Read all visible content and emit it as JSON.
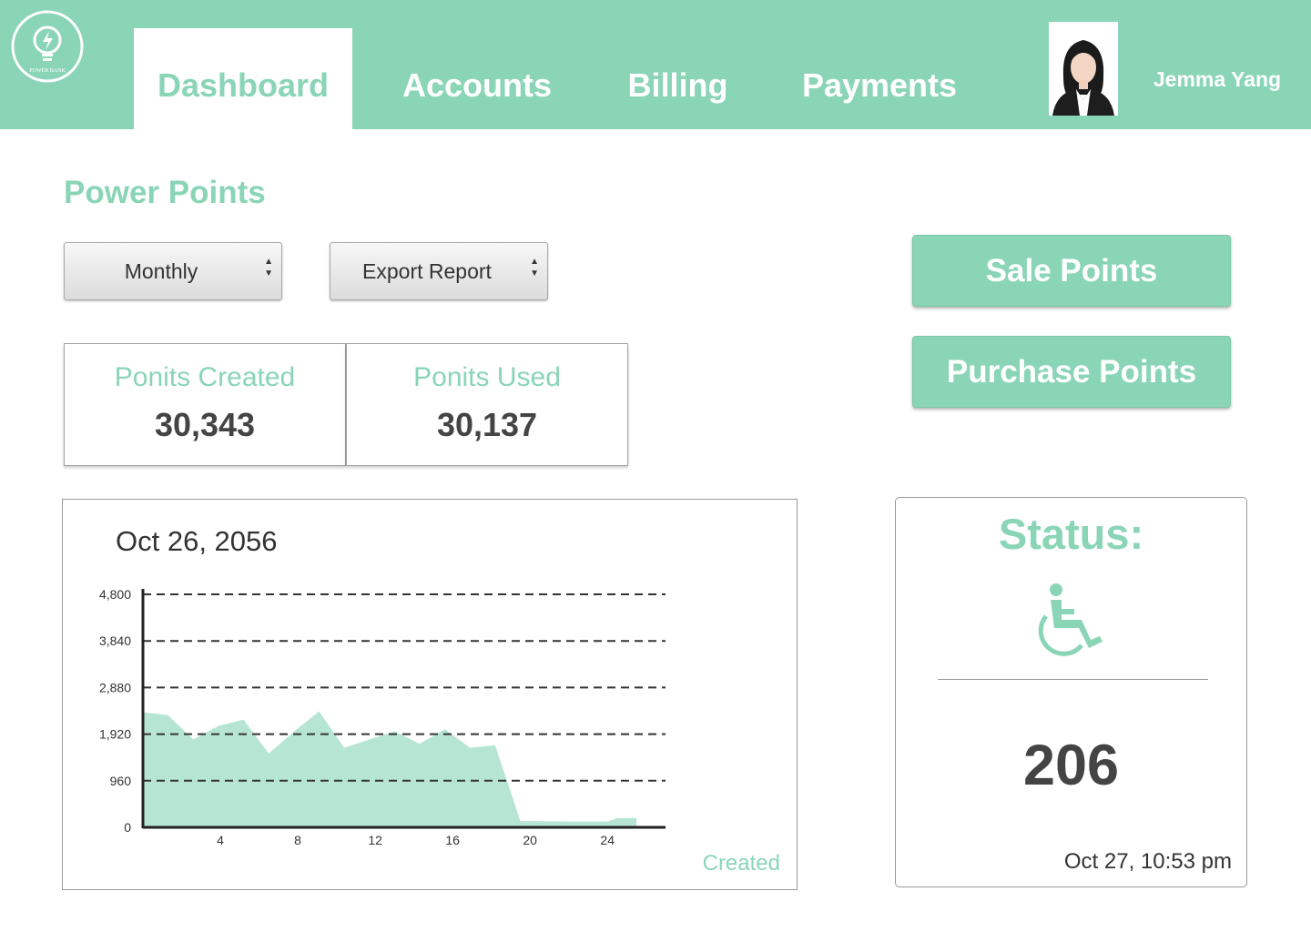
{
  "header": {
    "logo_text": "POWER BANK",
    "tabs": [
      {
        "label": "Dashboard",
        "active": true
      },
      {
        "label": "Accounts",
        "active": false
      },
      {
        "label": "Billing",
        "active": false
      },
      {
        "label": "Payments",
        "active": false
      }
    ],
    "user_name": "Jemma Yang"
  },
  "main": {
    "title": "Power Points",
    "period_select": "Monthly",
    "export_select": "Export Report",
    "stats": [
      {
        "label": "Ponits Created",
        "value": "30,343"
      },
      {
        "label": "Ponits Used",
        "value": "30,137"
      }
    ],
    "buttons": {
      "sale": "Sale Points",
      "purchase": "Purchase Points"
    }
  },
  "chart_data": {
    "type": "area",
    "title": "Oct 26, 2056",
    "xlabel": "",
    "ylabel": "",
    "x": [
      0,
      1.3,
      2.6,
      3.9,
      5.2,
      6.5,
      7.8,
      9.1,
      10.4,
      11.7,
      13,
      14.3,
      15.6,
      16.9,
      18.2,
      19.5,
      20.2,
      22.2,
      24,
      24.5,
      25.5
    ],
    "series": [
      {
        "name": "Created",
        "values": [
          2370,
          2310,
          1810,
          2090,
          2220,
          1520,
          1970,
          2390,
          1640,
          1810,
          1980,
          1720,
          2020,
          1640,
          1690,
          130,
          130,
          120,
          120,
          190,
          190
        ]
      }
    ],
    "xticks": [
      "4",
      "8",
      "12",
      "16",
      "20",
      "24"
    ],
    "yticks": [
      "0",
      "960",
      "1,920",
      "2,880",
      "3,840",
      "4,800"
    ],
    "xlim": [
      0,
      27
    ],
    "ylim": [
      0,
      4800
    ],
    "grid": true,
    "legend": "bottom-right",
    "color": "#b6e6d3"
  },
  "status": {
    "title": "Status:",
    "icon": "wheelchair-icon",
    "value": "206",
    "timestamp": "Oct 27, 10:53 pm"
  },
  "colors": {
    "accent": "#8ad5b6",
    "text": "#444444",
    "area": "#b6e6d3"
  }
}
